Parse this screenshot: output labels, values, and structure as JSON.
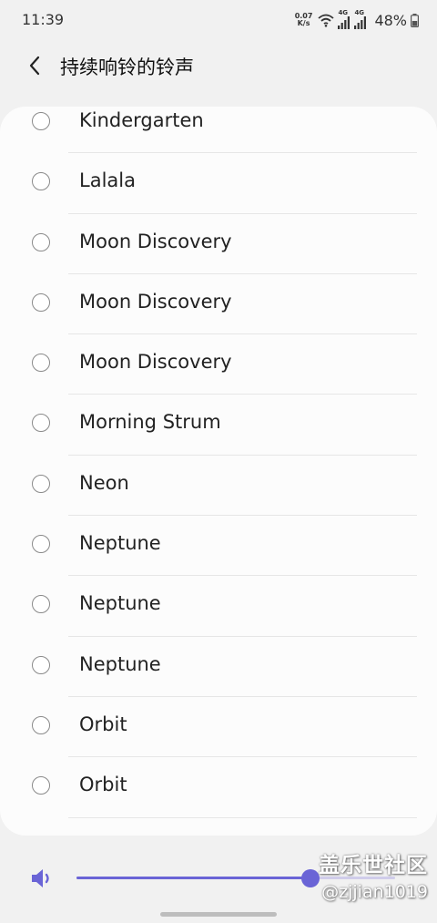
{
  "status_bar": {
    "time": "11:39",
    "net_speed_value": "0.07",
    "net_speed_unit": "K/s",
    "sim1_label": "4G",
    "sim2_label": "4G",
    "battery": "48%",
    "icons": [
      "wifi-icon",
      "signal-icon",
      "battery-icon"
    ]
  },
  "header": {
    "back_icon": "chevron-left-icon",
    "title": "持续响铃的铃声"
  },
  "ringtones": [
    {
      "label": "Kindergarten",
      "selected": false
    },
    {
      "label": "Lalala",
      "selected": false
    },
    {
      "label": "Moon Discovery",
      "selected": false
    },
    {
      "label": "Moon Discovery",
      "selected": false
    },
    {
      "label": "Moon Discovery",
      "selected": false
    },
    {
      "label": "Morning Strum",
      "selected": false
    },
    {
      "label": "Neon",
      "selected": false
    },
    {
      "label": "Neptune",
      "selected": false
    },
    {
      "label": "Neptune",
      "selected": false
    },
    {
      "label": "Neptune",
      "selected": false
    },
    {
      "label": "Orbit",
      "selected": false
    },
    {
      "label": "Orbit",
      "selected": false
    }
  ],
  "volume": {
    "icon": "speaker-icon",
    "level": 0.733
  },
  "watermark": {
    "line1": "盖乐世社区",
    "line2": "@zjjian1019"
  },
  "colors": {
    "accent": "#6a64d6",
    "background": "#f1f1f1",
    "card": "#fcfcfc"
  }
}
